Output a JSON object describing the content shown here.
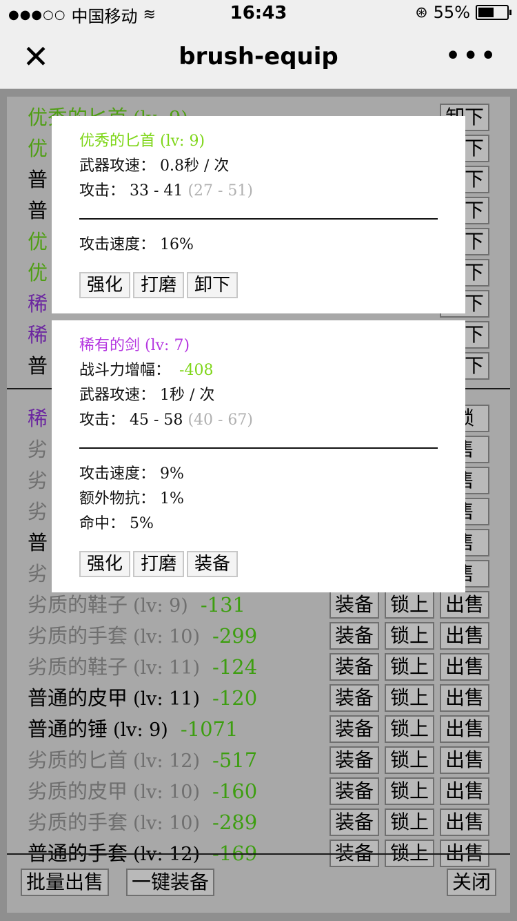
{
  "status": {
    "carrier": "中国移动",
    "time": "16:43",
    "battery": "55%",
    "battery_level": 0.55
  },
  "nav": {
    "title": "brush-equip"
  },
  "equipped": [
    {
      "name": "优秀的匕首",
      "level": "(lv: 9)",
      "quality": "good",
      "btn": "卸下"
    },
    {
      "name": "优",
      "level": "",
      "quality": "good",
      "btn": "卸下"
    },
    {
      "name": "普",
      "level": "",
      "quality": "normal",
      "btn": "卸下"
    },
    {
      "name": "普",
      "level": "",
      "quality": "normal",
      "btn": "卸下"
    },
    {
      "name": "优",
      "level": "",
      "quality": "good",
      "btn": "卸下"
    },
    {
      "name": "优",
      "level": "",
      "quality": "good",
      "btn": "卸下"
    },
    {
      "name": "稀",
      "level": "",
      "quality": "rare",
      "btn": "卸下"
    },
    {
      "name": "稀",
      "level": "",
      "quality": "rare",
      "btn": "卸下"
    },
    {
      "name": "普",
      "level": "",
      "quality": "normal",
      "btn": "卸下"
    }
  ],
  "inventory_partial": [
    {
      "name": "稀",
      "quality": "rare",
      "btn": "锁"
    },
    {
      "name": "劣",
      "quality": "poor",
      "btn": "售"
    },
    {
      "name": "劣",
      "quality": "poor",
      "btn": "售"
    },
    {
      "name": "劣",
      "quality": "poor",
      "btn": "售"
    },
    {
      "name": "普",
      "quality": "normal",
      "btn": "售"
    },
    {
      "name": "劣",
      "quality": "poor",
      "btn": "售"
    }
  ],
  "inventory": [
    {
      "name": "劣质的鞋子",
      "level": "(lv: 9)",
      "power": "-131",
      "quality": "poor"
    },
    {
      "name": "劣质的手套",
      "level": "(lv: 10)",
      "power": "-299",
      "quality": "poor"
    },
    {
      "name": "劣质的鞋子",
      "level": "(lv: 11)",
      "power": "-124",
      "quality": "poor"
    },
    {
      "name": "普通的皮甲",
      "level": "(lv: 11)",
      "power": "-120",
      "quality": "normal"
    },
    {
      "name": "普通的锤",
      "level": "(lv: 9)",
      "power": "-1071",
      "quality": "normal"
    },
    {
      "name": "劣质的匕首",
      "level": "(lv: 12)",
      "power": "-517",
      "quality": "poor"
    },
    {
      "name": "劣质的皮甲",
      "level": "(lv: 10)",
      "power": "-160",
      "quality": "poor"
    },
    {
      "name": "劣质的手套",
      "level": "(lv: 10)",
      "power": "-289",
      "quality": "poor"
    },
    {
      "name": "普通的手套",
      "level": "(lv: 12)",
      "power": "-169",
      "quality": "normal"
    }
  ],
  "row_buttons": {
    "equip": "装备",
    "lock": "锁上",
    "sell": "出售"
  },
  "bottom": {
    "bulk_sell": "批量出售",
    "auto_equip": "一键装备",
    "close": "关闭"
  },
  "popup1": {
    "title": "优秀的匕首 (lv: 9)",
    "speed_label": "武器攻速：",
    "speed_value": "0.8秒 / 次",
    "atk_label": "攻击：",
    "atk_value": "33 - 41",
    "atk_range": "(27 - 51)",
    "attrs": [
      {
        "label": "攻击速度：",
        "value": "16%"
      }
    ],
    "buttons": [
      "强化",
      "打磨",
      "卸下"
    ]
  },
  "popup2": {
    "title": "稀有的剑 (lv: 7)",
    "power_label": "战斗力增幅：",
    "power_value": "-408",
    "speed_label": "武器攻速：",
    "speed_value": "1秒 / 次",
    "atk_label": "攻击：",
    "atk_value": "45 - 58",
    "atk_range": "(40 - 67)",
    "attrs": [
      {
        "label": "攻击速度：",
        "value": "9%"
      },
      {
        "label": "额外物抗：",
        "value": "1%"
      },
      {
        "label": "命中：",
        "value": "5%"
      }
    ],
    "buttons": [
      "强化",
      "打磨",
      "装备"
    ]
  }
}
